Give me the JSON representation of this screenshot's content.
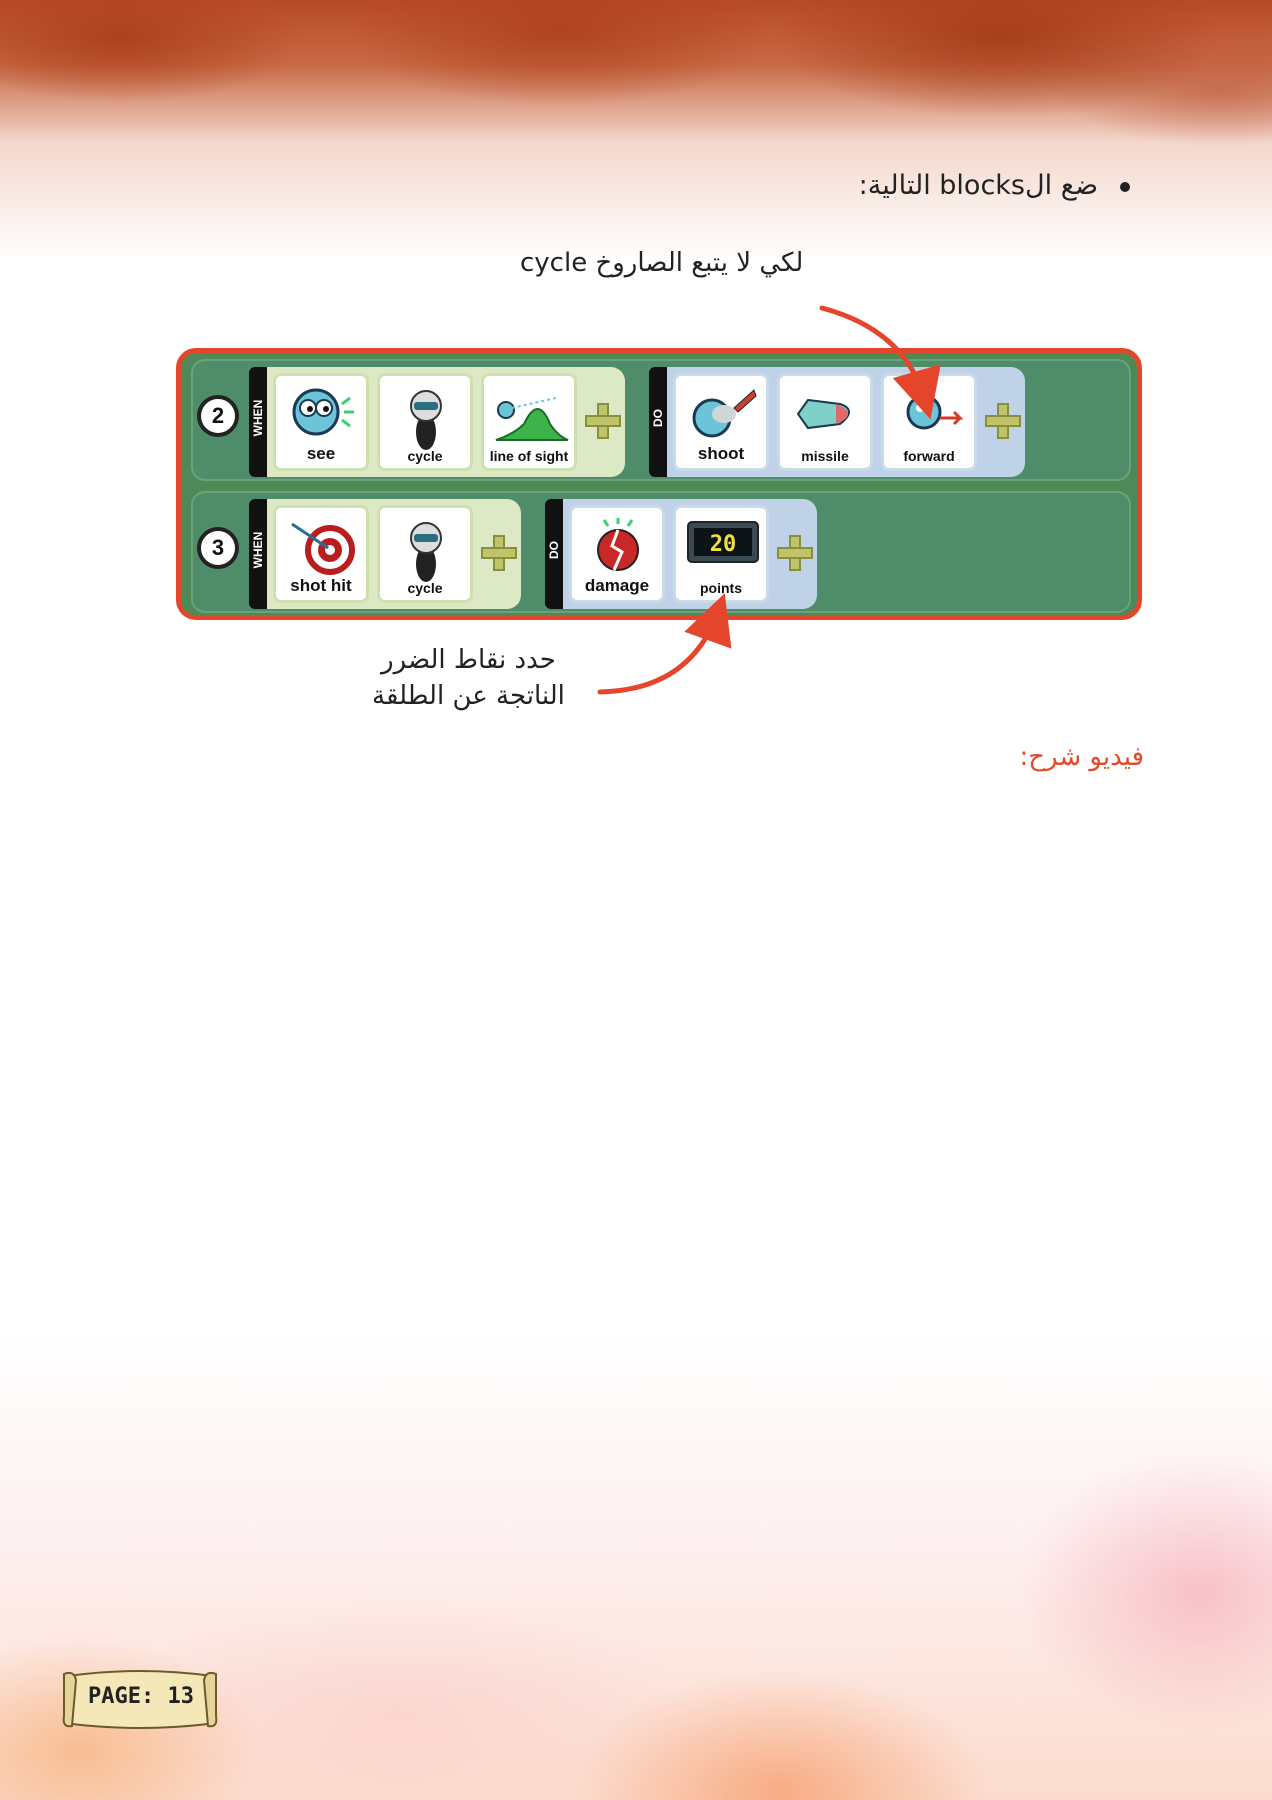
{
  "instruction": {
    "bullet": "ضع الblocks التالية:"
  },
  "annotations": {
    "top_note": "لكي لا يتبع الصاروخ cycle",
    "bottom_note_line1": "حدد نقاط الضرر",
    "bottom_note_line2": "الناتجة عن الطلقة"
  },
  "video_label": "فيديو شرح:",
  "rules": [
    {
      "number": "2",
      "when_label": "WHEN",
      "do_label": "DO",
      "when_tiles": [
        "see",
        "cycle",
        "line of sight"
      ],
      "do_tiles": [
        "shoot",
        "missile",
        "forward"
      ]
    },
    {
      "number": "3",
      "when_label": "WHEN",
      "do_label": "DO",
      "when_tiles": [
        "shot hit",
        "cycle"
      ],
      "do_tiles": [
        "damage",
        "points"
      ],
      "points_display": "20"
    }
  ],
  "footer": {
    "page_label": "PAGE: 13"
  },
  "colors": {
    "accent": "#e5452a",
    "video_label": "#e24a2a",
    "rule_background": "#4f8d6a"
  }
}
